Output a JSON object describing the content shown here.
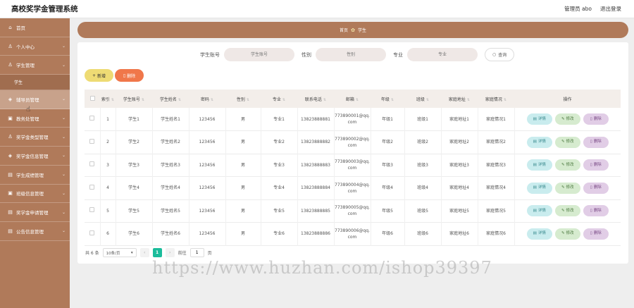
{
  "header": {
    "app_title": "高校奖学金管理系统",
    "user_label": "管理员 abo",
    "logout_label": "退出登录"
  },
  "sidebar": {
    "items": [
      {
        "label": "首页",
        "icon": "home-icon",
        "glyph": "⌂"
      },
      {
        "label": "个人中心",
        "icon": "user-icon",
        "glyph": "♙"
      },
      {
        "label": "学生管理",
        "icon": "user-icon",
        "glyph": "♙"
      },
      {
        "label": "辅导员管理",
        "icon": "shield-icon",
        "glyph": "◈"
      },
      {
        "label": "教务处管理",
        "icon": "box-icon",
        "glyph": "▣"
      },
      {
        "label": "奖学金类型管理",
        "icon": "user-icon",
        "glyph": "♙"
      },
      {
        "label": "奖学金信息管理",
        "icon": "shield-icon",
        "glyph": "◈"
      },
      {
        "label": "学生成绩管理",
        "icon": "doc-icon",
        "glyph": "▤"
      },
      {
        "label": "班级信息管理",
        "icon": "box-icon",
        "glyph": "▣"
      },
      {
        "label": "奖学金申请管理",
        "icon": "doc-icon",
        "glyph": "▤"
      },
      {
        "label": "公告信息管理",
        "icon": "doc-icon",
        "glyph": "▤"
      }
    ],
    "submenu_label": "学生"
  },
  "breadcrumb": {
    "home": "首页",
    "current": "学生"
  },
  "search": {
    "fields": [
      {
        "label": "学生账号",
        "placeholder": "学生账号"
      },
      {
        "label": "性别",
        "placeholder": "性别"
      },
      {
        "label": "专业",
        "placeholder": "专业"
      }
    ],
    "button_label": "查询"
  },
  "actions": {
    "add_label": "新增",
    "delete_label": "删除"
  },
  "table": {
    "columns": [
      "索引",
      "学生账号",
      "学生姓名",
      "密码",
      "性别",
      "专业",
      "联系电话",
      "邮箱",
      "年级",
      "班级",
      "家庭地址",
      "家庭情况",
      "操作"
    ],
    "rows": [
      [
        "1",
        "学生1",
        "学生姓名1",
        "123456",
        "男",
        "专业1",
        "13823888881",
        "773890001@qq.com",
        "年级1",
        "班级1",
        "家庭地址1",
        "家庭情况1"
      ],
      [
        "2",
        "学生2",
        "学生姓名2",
        "123456",
        "男",
        "专业2",
        "13823888882",
        "773890002@qq.com",
        "年级2",
        "班级2",
        "家庭地址2",
        "家庭情况2"
      ],
      [
        "3",
        "学生3",
        "学生姓名3",
        "123456",
        "男",
        "专业3",
        "13823888883",
        "773890003@qq.com",
        "年级3",
        "班级3",
        "家庭地址3",
        "家庭情况3"
      ],
      [
        "4",
        "学生4",
        "学生姓名4",
        "123456",
        "男",
        "专业4",
        "13823888884",
        "773890004@qq.com",
        "年级4",
        "班级4",
        "家庭地址4",
        "家庭情况4"
      ],
      [
        "5",
        "学生5",
        "学生姓名5",
        "123456",
        "男",
        "专业5",
        "13823888885",
        "773890005@qq.com",
        "年级5",
        "班级5",
        "家庭地址5",
        "家庭情况5"
      ],
      [
        "6",
        "学生6",
        "学生姓名6",
        "123456",
        "男",
        "专业6",
        "13823888886",
        "773890006@qq.com",
        "年级6",
        "班级6",
        "家庭地址6",
        "家庭情况6"
      ]
    ],
    "row_actions": {
      "detail": "详情",
      "edit": "修改",
      "delete": "删除"
    }
  },
  "pagination": {
    "total": "共 6 条",
    "page_size": "10条/页",
    "current_page": "1",
    "goto_label": "前往",
    "goto_value": "1",
    "page_unit": "页"
  },
  "watermark": "https://www.huzhan.com/ishop39397",
  "colors": {
    "sidebar": "#b07a5a",
    "add_button": "#eedb74",
    "delete_button": "#f0774a",
    "pager_current": "#1bbc9b"
  }
}
